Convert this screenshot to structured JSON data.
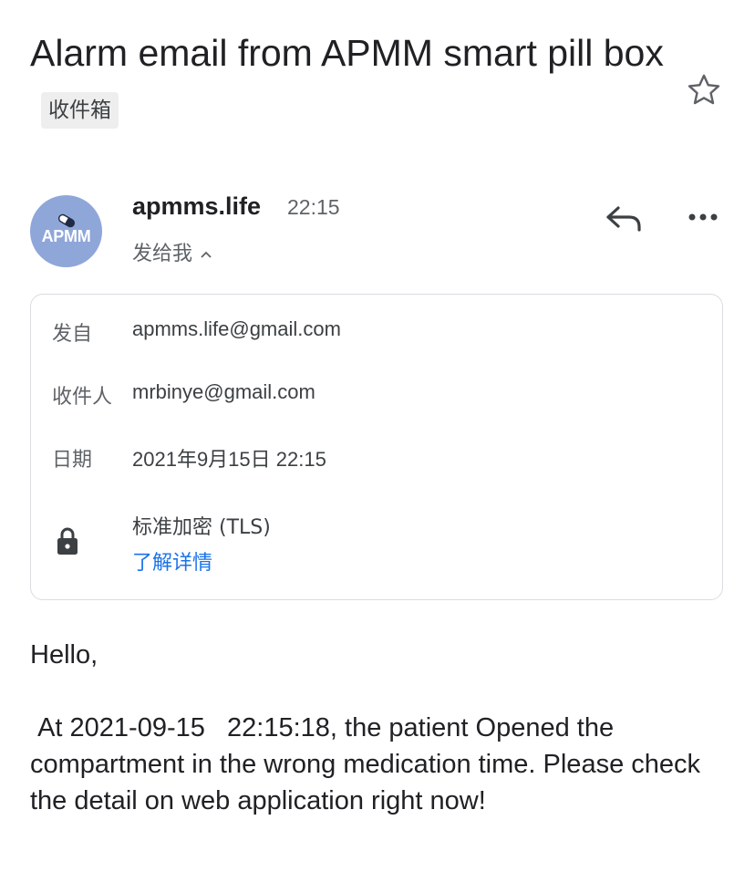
{
  "email": {
    "subject": "Alarm email from APMM smart pill box",
    "label": "收件箱"
  },
  "sender": {
    "name": "apmms.life",
    "time": "22:15",
    "recipient_summary": "发给我",
    "avatar_text": "APMM"
  },
  "details": {
    "from_label": "发自",
    "from_value": "apmms.life@gmail.com",
    "to_label": "收件人",
    "to_value": "mrbinye@gmail.com",
    "date_label": "日期",
    "date_value": "2021年9月15日 22:15",
    "encryption_label": "标准加密 (TLS)",
    "learn_more": "了解详情"
  },
  "body": {
    "greeting": "Hello,",
    "message": " At 2021-09-15   22:15:18, the patient Opened the compartment in the wrong medication time. Please check the detail on web application right now!"
  },
  "icons": {
    "star": "star-outline-icon",
    "reply": "reply-icon",
    "more": "more-horizontal-icon",
    "lock": "lock-icon",
    "chevron": "chevron-up-icon",
    "avatar_pill": "pill-icon"
  },
  "colors": {
    "avatar_bg": "#8fa6d9",
    "link": "#1a73e8",
    "chip_bg": "#eeeeee",
    "secondary_text": "#5f6368"
  }
}
